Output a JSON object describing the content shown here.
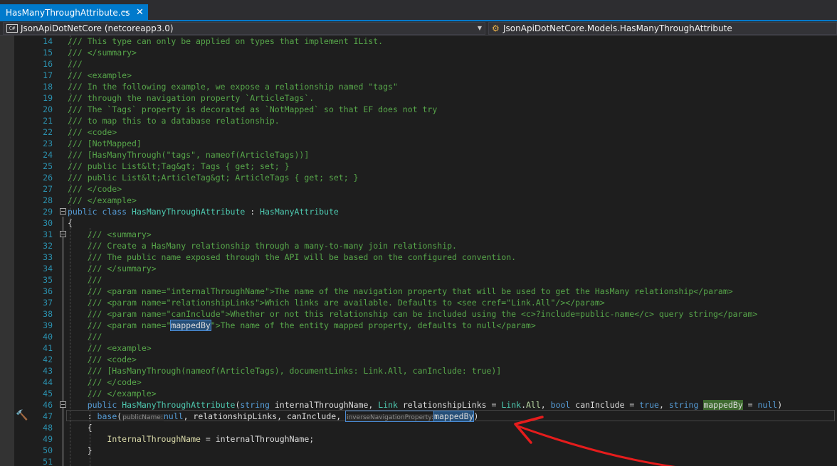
{
  "tab": {
    "title": "HasManyThroughAttribute.cs",
    "pin_icon": "pin-icon",
    "close_icon": "close-icon"
  },
  "navbar": {
    "project": "JsonApiDotNetCore (netcoreapp3.0)",
    "member": "JsonApiDotNetCore.Models.HasManyThroughAttribute"
  },
  "editor": {
    "line_numbers": [
      "14",
      "15",
      "16",
      "17",
      "18",
      "19",
      "20",
      "21",
      "22",
      "23",
      "24",
      "25",
      "26",
      "27",
      "28",
      "29",
      "30",
      "31",
      "32",
      "33",
      "34",
      "35",
      "36",
      "37",
      "38",
      "39",
      "40",
      "41",
      "42",
      "43",
      "44",
      "45",
      "46",
      "47",
      "48",
      "49",
      "50",
      "51"
    ],
    "lines": [
      "/// This type can only be applied on types that implement IList.",
      "/// </summary>",
      "///",
      "/// <example>",
      "/// In the following example, we expose a relationship named \"tags\"",
      "/// through the navigation property `ArticleTags`.",
      "/// The `Tags` property is decorated as `NotMapped` so that EF does not try",
      "/// to map this to a database relationship.",
      "/// <code>",
      "/// [NotMapped]",
      "/// [HasManyThrough(\"tags\", nameof(ArticleTags))]",
      "/// public List&lt;Tag&gt; Tags { get; set; }",
      "/// public List&lt;ArticleTag&gt; ArticleTags { get; set; }",
      "/// </code>",
      "/// </example>",
      "public class HasManyThroughAttribute : HasManyAttribute",
      "{",
      "    /// <summary>",
      "    /// Create a HasMany relationship through a many-to-many join relationship.",
      "    /// The public name exposed through the API will be based on the configured convention.",
      "    /// </summary>",
      "    ///",
      "    /// <param name=\"internalThroughName\">The name of the navigation property that will be used to get the HasMany relationship</param>",
      "    /// <param name=\"relationshipLinks\">Which links are available. Defaults to <see cref=\"Link.All\"/></param>",
      "    /// <param name=\"canInclude\">Whether or not this relationship can be included using the <c>?include=public-name</c> query string</param>",
      "    /// <param name=\"mappedBy\">The name of the entity mapped property, defaults to null</param>",
      "    ///",
      "    /// <example>",
      "    /// <code>",
      "    /// [HasManyThrough(nameof(ArticleTags), documentLinks: Link.All, canInclude: true)]",
      "    /// </code>",
      "    /// </example>",
      "    public HasManyThroughAttribute(string internalThroughName, Link relationshipLinks = Link.All, bool canInclude = true, string mappedBy = null)",
      "    : base(publicName:null, relationshipLinks, canInclude, inverseNavigationProperty:mappedBy)",
      "    {",
      "        InternalThroughName = internalThroughName;",
      "    }",
      ""
    ],
    "inlay_hints": {
      "public_name": "publicName:",
      "inverse_navigation": "inverseNavigationProperty:"
    }
  },
  "colors": {
    "accent": "#007acc",
    "annotation_arrow": "#e51c1c",
    "comment": "#57a64a",
    "keyword": "#569cd6",
    "type": "#4ec9b0",
    "line_number": "#2b91af"
  }
}
